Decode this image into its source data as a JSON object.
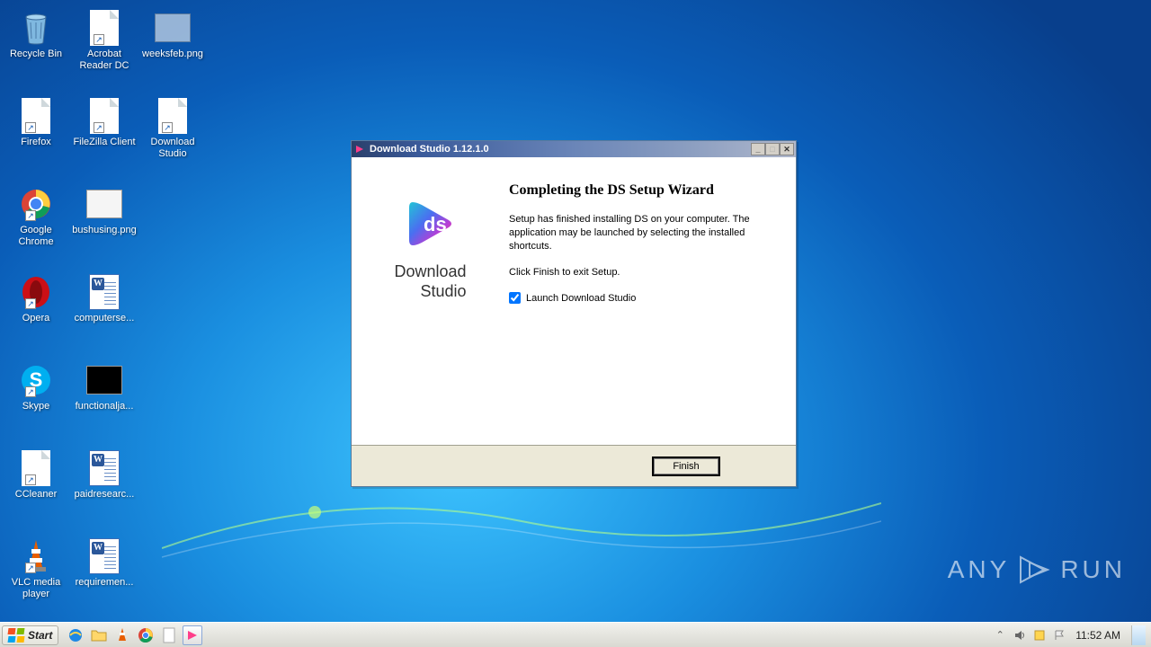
{
  "desktop": {
    "icons": [
      {
        "label": "Recycle Bin",
        "name": "recycle-bin"
      },
      {
        "label": "Firefox",
        "name": "firefox"
      },
      {
        "label": "Google Chrome",
        "name": "chrome"
      },
      {
        "label": "Opera",
        "name": "opera"
      },
      {
        "label": "Skype",
        "name": "skype"
      },
      {
        "label": "CCleaner",
        "name": "ccleaner"
      },
      {
        "label": "VLC media player",
        "name": "vlc"
      },
      {
        "label": "Acrobat Reader DC",
        "name": "acrobat"
      },
      {
        "label": "FileZilla Client",
        "name": "filezilla"
      },
      {
        "label": "bushusing.png",
        "name": "bushusing"
      },
      {
        "label": "computerse...",
        "name": "computerse"
      },
      {
        "label": "functionalja...",
        "name": "functionalja"
      },
      {
        "label": "paidresearc...",
        "name": "paidresearc"
      },
      {
        "label": "requiremen...",
        "name": "requiremen"
      },
      {
        "label": "weeksfeb.png",
        "name": "weeksfeb"
      },
      {
        "label": "Download Studio",
        "name": "download-studio"
      }
    ]
  },
  "dialog": {
    "title": "Download Studio 1.12.1.0",
    "logo_line1": "Download",
    "logo_line2": "Studio",
    "heading": "Completing the DS Setup Wizard",
    "para1": "Setup has finished installing DS on your computer. The application may be launched by selecting the installed shortcuts.",
    "para2": "Click Finish to exit Setup.",
    "checkbox_label": "Launch Download Studio",
    "checkbox_checked": true,
    "finish": "Finish"
  },
  "taskbar": {
    "start": "Start",
    "clock": "11:52 AM"
  },
  "watermark": {
    "a": "ANY",
    "b": "RUN"
  }
}
